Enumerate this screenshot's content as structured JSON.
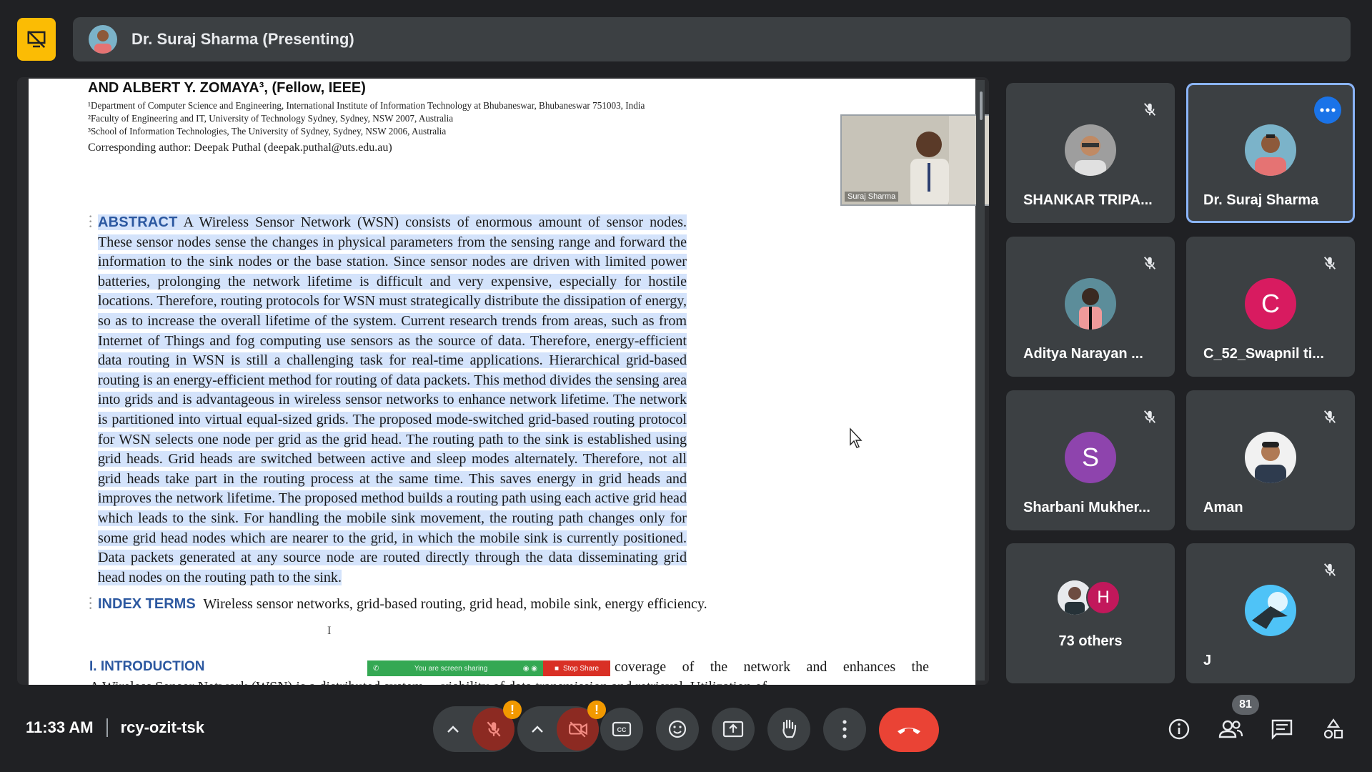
{
  "presenter": {
    "name": "Dr. Suraj Sharma (Presenting)"
  },
  "document": {
    "authors": "AND ALBERT Y. ZOMAYA³, (Fellow, IEEE)",
    "affiliations": [
      "¹Department of Computer Science and Engineering, International Institute of Information Technology at Bhubaneswar, Bhubaneswar 751003, India",
      "²Faculty of Engineering and IT, University of Technology Sydney, Sydney, NSW 2007, Australia",
      "³School of Information Technologies, The University of Sydney, Sydney, NSW 2006, Australia"
    ],
    "corresponding": "Corresponding author: Deepak Puthal (deepak.puthal@uts.edu.au)",
    "abstract_heading": "ABSTRACT",
    "abstract_text": "A Wireless Sensor Network (WSN) consists of enormous amount of sensor nodes. These sensor nodes sense the changes in physical parameters from the sensing range and forward the information to the sink nodes or the base station. Since sensor nodes are driven with limited power batteries, prolonging the network lifetime is difficult and very expensive, especially for hostile locations. Therefore, routing protocols for WSN must strategically distribute the dissipation of energy, so as to increase the overall lifetime of the system. Current research trends from areas, such as from Internet of Things and fog computing use sensors as the source of data. Therefore, energy-efficient data routing in WSN is still a challenging task for real-time applications. Hierarchical grid-based routing is an energy-efficient method for routing of data packets. This method divides the sensing area into grids and is advantageous in wireless sensor networks to enhance network lifetime. The network is partitioned into virtual equal-sized grids. The proposed mode-switched grid-based routing protocol for WSN selects one node per grid as the grid head. The routing path to the sink is established using grid heads. Grid heads are switched between active and sleep modes alternately. Therefore, not all grid heads take part in the routing process at the same time. This saves energy in grid heads and improves the network lifetime. The proposed method builds a routing path using each active grid head which leads to the sink. For handling the mobile sink movement, the routing path changes only for some grid head nodes which are nearer to the grid, in which the mobile sink is currently positioned. Data packets generated at any source node are routed directly through the data disseminating grid head nodes on the routing path to the sink.",
    "index_terms_heading": "INDEX TERMS",
    "index_terms_text": "Wireless sensor networks, grid-based routing, grid head, mobile sink, energy efficiency.",
    "intro_heading": "I. INTRODUCTION",
    "intro_right": "coverage of the network and enhances the",
    "intro_cut": "A Wireless Sensor Network (WSN) is a distributed system ... viability of data transmission and retrieval. Utilization of"
  },
  "share_strip": {
    "sharing": "You are screen sharing",
    "stop": "Stop Share"
  },
  "self_view": {
    "name": "Suraj Sharma"
  },
  "participants": [
    {
      "name": "SHANKAR TRIPA...",
      "muted": true
    },
    {
      "name": "Dr. Suraj Sharma",
      "muted": false,
      "active": true
    },
    {
      "name": "Aditya Narayan ...",
      "muted": true
    },
    {
      "name": "C_52_Swapnil ti...",
      "initial": "C",
      "color": "#d81b60",
      "muted": true
    },
    {
      "name": "Sharbani Mukher...",
      "initial": "S",
      "color": "#8e44ad",
      "muted": true
    },
    {
      "name": "Aman",
      "muted": true
    },
    {
      "name": "J",
      "muted": true
    }
  ],
  "others": {
    "label": "73 others",
    "initial": "H"
  },
  "meeting": {
    "time": "11:33 AM",
    "code": "rcy-ozit-tsk"
  },
  "controls": {
    "mic_badge": "!",
    "cam_badge": "!",
    "people_count": "81"
  },
  "colors": {
    "accent": "#8ab4f8",
    "hangup": "#ea4335",
    "presenting": "#fbbc04",
    "highlight": "#d4e3fb"
  },
  "icons": [
    "presentation-off-icon",
    "mic-off-icon",
    "camera-off-icon",
    "captions-icon",
    "emoji-icon",
    "present-icon",
    "raise-hand-icon",
    "more-options-icon",
    "hangup-icon",
    "info-icon",
    "people-icon",
    "chat-icon",
    "activities-icon"
  ]
}
